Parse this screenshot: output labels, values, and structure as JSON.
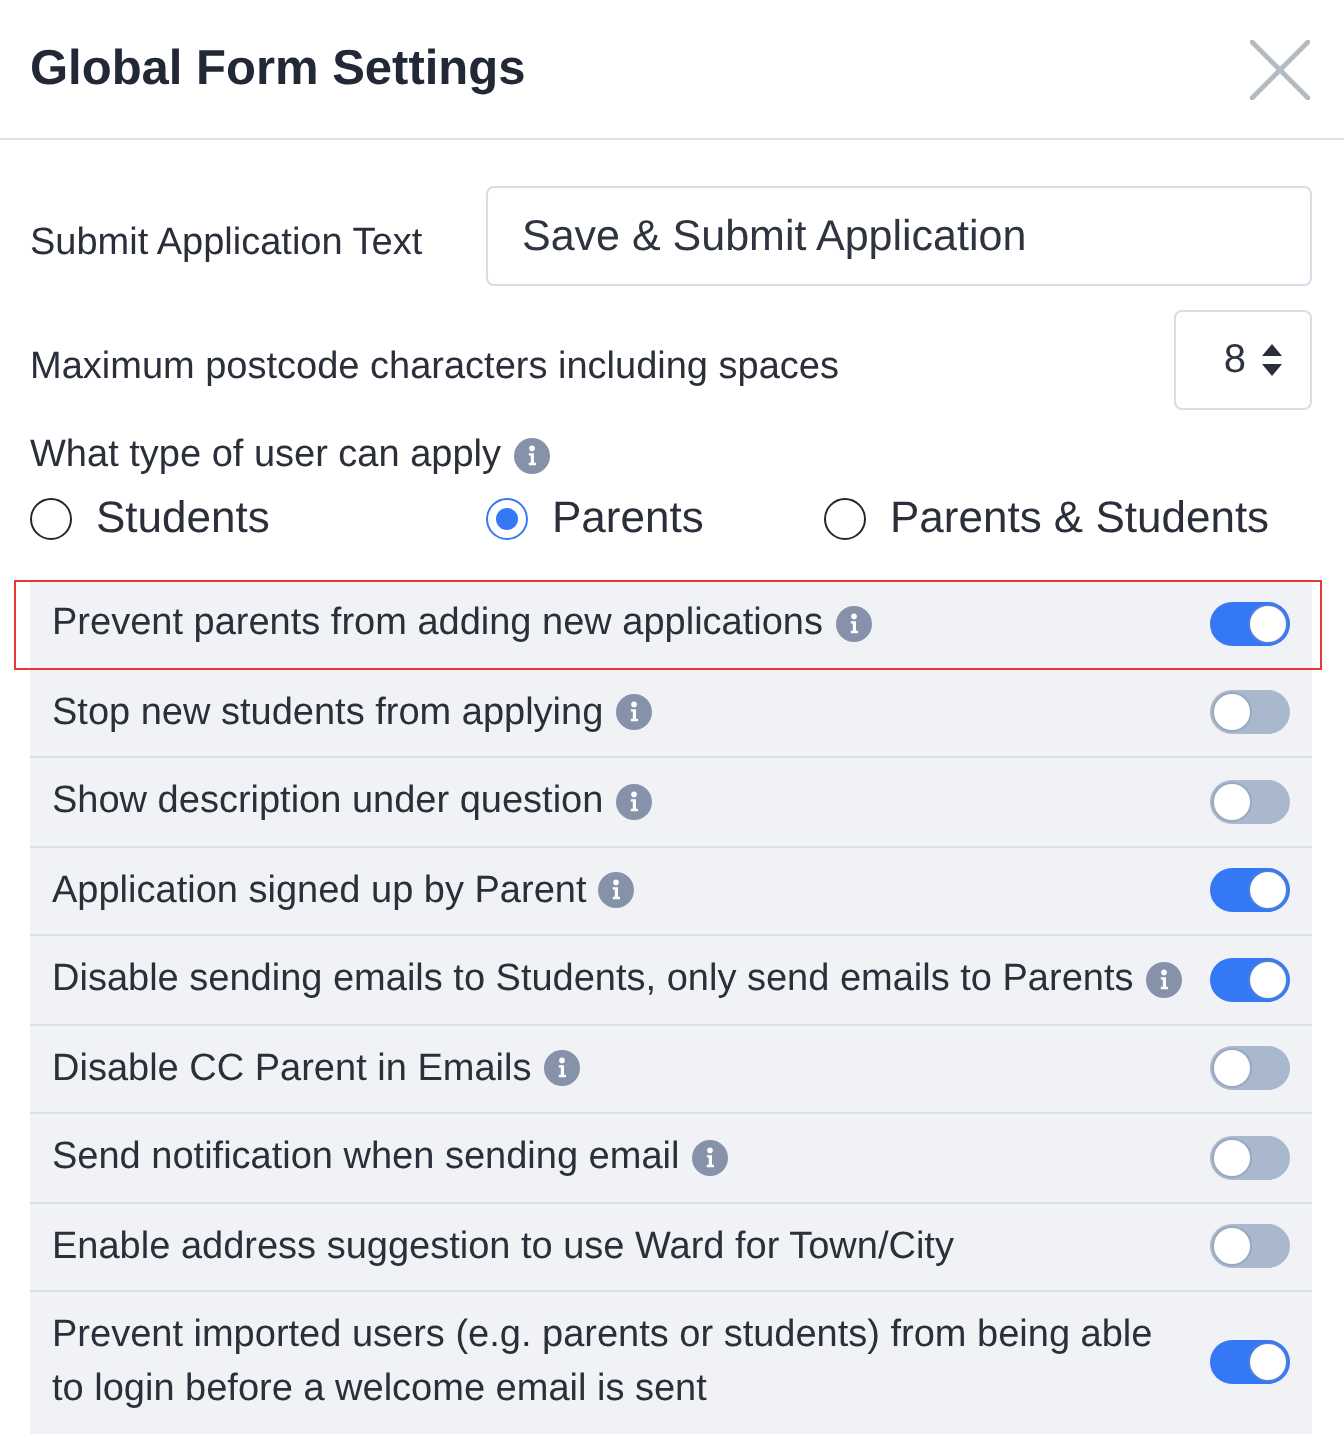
{
  "dialog": {
    "title": "Global Form Settings"
  },
  "fields": [
    {
      "kind": "text",
      "label": "Submit Application Text",
      "value": "Save & Submit Application"
    },
    {
      "kind": "number",
      "label": "Maximum postcode characters including spaces",
      "value": "8"
    }
  ],
  "user_type": {
    "label": "What type of user can apply",
    "info": true,
    "options": [
      {
        "label": "Students",
        "selected": false
      },
      {
        "label": "Parents",
        "selected": true
      },
      {
        "label": "Parents & Students",
        "selected": false
      }
    ]
  },
  "toggles": [
    {
      "label": "Prevent parents from adding new applications",
      "info": true,
      "on": true,
      "highlighted": true
    },
    {
      "label": "Stop new students from applying",
      "info": true,
      "on": false,
      "highlighted": false
    },
    {
      "label": "Show description under question",
      "info": true,
      "on": false,
      "highlighted": false
    },
    {
      "label": "Application signed up by Parent",
      "info": true,
      "on": true,
      "highlighted": false
    },
    {
      "label": "Disable sending emails to Students, only send emails to Parents",
      "info": true,
      "on": true,
      "highlighted": false
    },
    {
      "label": "Disable CC Parent in Emails",
      "info": true,
      "on": false,
      "highlighted": false
    },
    {
      "label": "Send notification when sending email",
      "info": true,
      "on": false,
      "highlighted": false
    },
    {
      "label": "Enable address suggestion to use Ward for Town/City",
      "info": false,
      "on": false,
      "highlighted": false
    },
    {
      "label": "Prevent imported users (e.g. parents or students) from being able to login before a welcome email is sent",
      "info": false,
      "on": true,
      "highlighted": false
    }
  ]
}
